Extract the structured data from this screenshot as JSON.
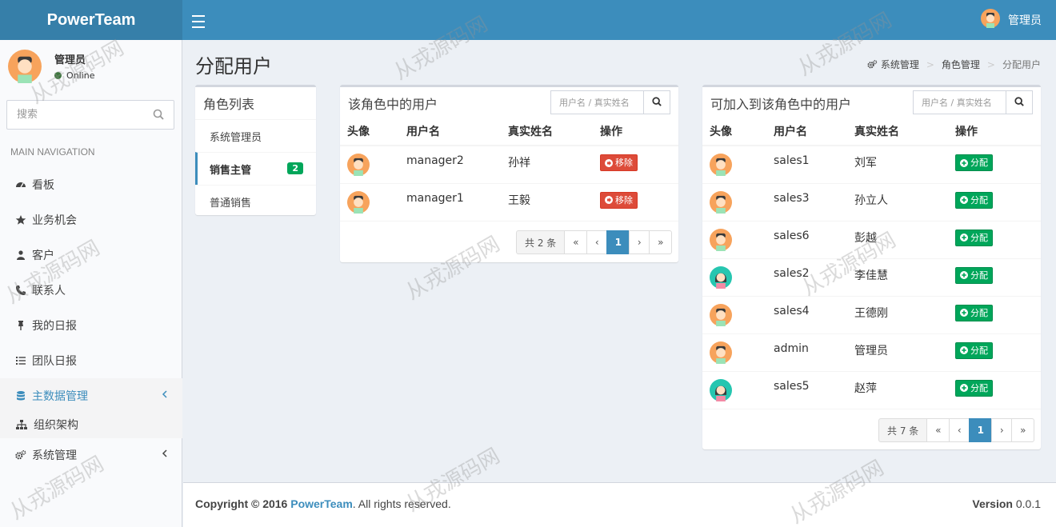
{
  "header": {
    "logo": "PowerTeam",
    "user_name": "管理员"
  },
  "sidebar": {
    "user_name": "管理员",
    "status": "Online",
    "search_placeholder": "搜索",
    "nav_header": "MAIN NAVIGATION",
    "items": [
      {
        "label": "看板",
        "icon": "dashboard-icon"
      },
      {
        "label": "业务机会",
        "icon": "star-icon"
      },
      {
        "label": "客户",
        "icon": "users-icon"
      },
      {
        "label": "联系人",
        "icon": "phone-icon"
      },
      {
        "label": "我的日报",
        "icon": "pin-icon"
      },
      {
        "label": "团队日报",
        "icon": "list-icon"
      },
      {
        "label": "主数据管理",
        "icon": "database-icon",
        "active": true
      },
      {
        "label": "系统管理",
        "icon": "cogs-icon"
      }
    ],
    "subitem": {
      "label": "组织架构",
      "icon": "sitemap-icon"
    }
  },
  "page": {
    "title": "分配用户",
    "breadcrumb": [
      "系统管理",
      "角色管理",
      "分配用户"
    ]
  },
  "roles": {
    "title": "角色列表",
    "items": [
      {
        "label": "系统管理员"
      },
      {
        "label": "销售主管",
        "badge": "2",
        "active": true
      },
      {
        "label": "普通销售"
      }
    ]
  },
  "in_role": {
    "title": "该角色中的用户",
    "search_placeholder": "用户名 / 真实姓名",
    "columns": [
      "头像",
      "用户名",
      "真实姓名",
      "操作"
    ],
    "rows": [
      {
        "username": "manager2",
        "realname": "孙祥",
        "avatar": "male",
        "action": "移除"
      },
      {
        "username": "manager1",
        "realname": "王毅",
        "avatar": "male",
        "action": "移除"
      }
    ],
    "pager": {
      "total": "共 2 条",
      "first": "«",
      "prev": "‹",
      "page": "1",
      "next": "›",
      "last": "»"
    }
  },
  "available": {
    "title": "可加入到该角色中的用户",
    "search_placeholder": "用户名 / 真实姓名",
    "columns": [
      "头像",
      "用户名",
      "真实姓名",
      "操作"
    ],
    "rows": [
      {
        "username": "sales1",
        "realname": "刘军",
        "avatar": "male",
        "action": "分配"
      },
      {
        "username": "sales3",
        "realname": "孙立人",
        "avatar": "male",
        "action": "分配"
      },
      {
        "username": "sales6",
        "realname": "彭越",
        "avatar": "male",
        "action": "分配"
      },
      {
        "username": "sales2",
        "realname": "李佳慧",
        "avatar": "female",
        "action": "分配"
      },
      {
        "username": "sales4",
        "realname": "王德刚",
        "avatar": "male",
        "action": "分配"
      },
      {
        "username": "admin",
        "realname": "管理员",
        "avatar": "male",
        "action": "分配"
      },
      {
        "username": "sales5",
        "realname": "赵萍",
        "avatar": "female",
        "action": "分配"
      }
    ],
    "pager": {
      "total": "共 7 条",
      "first": "«",
      "prev": "‹",
      "page": "1",
      "next": "›",
      "last": "»"
    }
  },
  "footer": {
    "copyright_prefix": "Copyright © 2016 ",
    "brand": "PowerTeam",
    "copyright_suffix": ". All rights reserved.",
    "version_label": "Version",
    "version": "0.0.1"
  },
  "watermark": "从戎源码网",
  "colors": {
    "primary": "#3c8dbc",
    "logo_bg": "#367fa9",
    "danger": "#dd4b39",
    "success": "#00a65a",
    "page_bg": "#ecf0f5"
  }
}
